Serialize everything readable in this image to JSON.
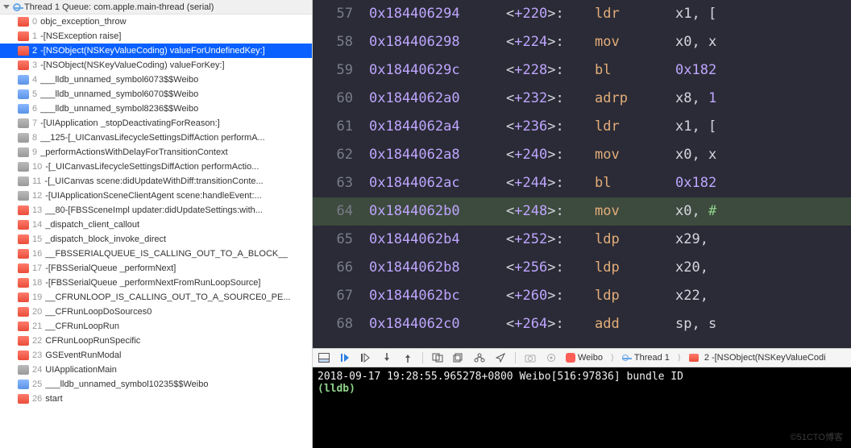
{
  "thread": {
    "header": "Thread 1 Queue: com.apple.main-thread (serial)"
  },
  "frames": [
    {
      "num": "0",
      "icon": "red",
      "label": "objc_exception_throw"
    },
    {
      "num": "1",
      "icon": "red",
      "label": "-[NSException raise]"
    },
    {
      "num": "2",
      "icon": "red",
      "label": "-[NSObject(NSKeyValueCoding) valueForUndefinedKey:]",
      "selected": true
    },
    {
      "num": "3",
      "icon": "red",
      "label": "-[NSObject(NSKeyValueCoding) valueForKey:]"
    },
    {
      "num": "4",
      "icon": "blue",
      "label": "___lldb_unnamed_symbol6073$$Weibo"
    },
    {
      "num": "5",
      "icon": "blue",
      "label": "___lldb_unnamed_symbol6070$$Weibo"
    },
    {
      "num": "6",
      "icon": "blue",
      "label": "___lldb_unnamed_symbol8236$$Weibo"
    },
    {
      "num": "7",
      "icon": "gray",
      "label": "-[UIApplication _stopDeactivatingForReason:]"
    },
    {
      "num": "8",
      "icon": "gray",
      "label": "__125-[_UICanvasLifecycleSettingsDiffAction performA..."
    },
    {
      "num": "9",
      "icon": "gray",
      "label": "_performActionsWithDelayForTransitionContext"
    },
    {
      "num": "10",
      "icon": "gray",
      "label": "-[_UICanvasLifecycleSettingsDiffAction performActio..."
    },
    {
      "num": "11",
      "icon": "gray",
      "label": "-[_UICanvas scene:didUpdateWithDiff:transitionConte..."
    },
    {
      "num": "12",
      "icon": "gray",
      "label": "-[UIApplicationSceneClientAgent scene:handleEvent:..."
    },
    {
      "num": "13",
      "icon": "red",
      "label": "__80-[FBSSceneImpl updater:didUpdateSettings:with..."
    },
    {
      "num": "14",
      "icon": "red",
      "label": "_dispatch_client_callout"
    },
    {
      "num": "15",
      "icon": "red",
      "label": "_dispatch_block_invoke_direct"
    },
    {
      "num": "16",
      "icon": "red",
      "label": "__FBSSERIALQUEUE_IS_CALLING_OUT_TO_A_BLOCK__"
    },
    {
      "num": "17",
      "icon": "red",
      "label": "-[FBSSerialQueue _performNext]"
    },
    {
      "num": "18",
      "icon": "red",
      "label": "-[FBSSerialQueue _performNextFromRunLoopSource]"
    },
    {
      "num": "19",
      "icon": "red",
      "label": "__CFRUNLOOP_IS_CALLING_OUT_TO_A_SOURCE0_PE..."
    },
    {
      "num": "20",
      "icon": "red",
      "label": "__CFRunLoopDoSources0"
    },
    {
      "num": "21",
      "icon": "red",
      "label": "__CFRunLoopRun"
    },
    {
      "num": "22",
      "icon": "red",
      "label": "CFRunLoopRunSpecific"
    },
    {
      "num": "23",
      "icon": "red",
      "label": "GSEventRunModal"
    },
    {
      "num": "24",
      "icon": "gray",
      "label": "UIApplicationMain"
    },
    {
      "num": "25",
      "icon": "blue",
      "label": "___lldb_unnamed_symbol10235$$Weibo"
    },
    {
      "num": "26",
      "icon": "red",
      "label": "start"
    }
  ],
  "asm": [
    {
      "ln": "57",
      "addr": "0x184406294",
      "off": "+220",
      "instr": "ldr",
      "ops": "x1, ["
    },
    {
      "ln": "58",
      "addr": "0x184406298",
      "off": "+224",
      "instr": "mov",
      "ops": "x0, x"
    },
    {
      "ln": "59",
      "addr": "0x18440629c",
      "off": "+228",
      "instr": "bl",
      "ops_purple": "0x182"
    },
    {
      "ln": "60",
      "addr": "0x1844062a0",
      "off": "+232",
      "instr": "adrp",
      "ops": "x8, ",
      "ops_purple": "1"
    },
    {
      "ln": "61",
      "addr": "0x1844062a4",
      "off": "+236",
      "instr": "ldr",
      "ops": "x1, ["
    },
    {
      "ln": "62",
      "addr": "0x1844062a8",
      "off": "+240",
      "instr": "mov",
      "ops": "x0, x"
    },
    {
      "ln": "63",
      "addr": "0x1844062ac",
      "off": "+244",
      "instr": "bl",
      "ops_purple": "0x182"
    },
    {
      "ln": "64",
      "addr": "0x1844062b0",
      "off": "+248",
      "instr": "mov",
      "ops": "x0, ",
      "ops_green": "#",
      "hl": true
    },
    {
      "ln": "65",
      "addr": "0x1844062b4",
      "off": "+252",
      "instr": "ldp",
      "ops": "x29,"
    },
    {
      "ln": "66",
      "addr": "0x1844062b8",
      "off": "+256",
      "instr": "ldp",
      "ops": "x20,"
    },
    {
      "ln": "67",
      "addr": "0x1844062bc",
      "off": "+260",
      "instr": "ldp",
      "ops": "x22,"
    },
    {
      "ln": "68",
      "addr": "0x1844062c0",
      "off": "+264",
      "instr": "add",
      "ops": "sp, s"
    }
  ],
  "debugbar": {
    "icons": [
      "toggle",
      "continue",
      "step-over",
      "step-in",
      "step-out",
      "sep",
      "debug-view",
      "memory",
      "hierarchy",
      "location",
      "sep",
      "camera",
      "settings"
    ],
    "breadcrumb": {
      "app": "Weibo",
      "thread": "Thread 1",
      "frame_num": "2",
      "frame_label": "-[NSObject(NSKeyValueCodi"
    }
  },
  "console": {
    "log": "2018-09-17 19:28:55.965278+0800 Weibo[516:97836] bundle ID",
    "prompt": "(lldb)"
  },
  "watermark": "©51CTO博客"
}
